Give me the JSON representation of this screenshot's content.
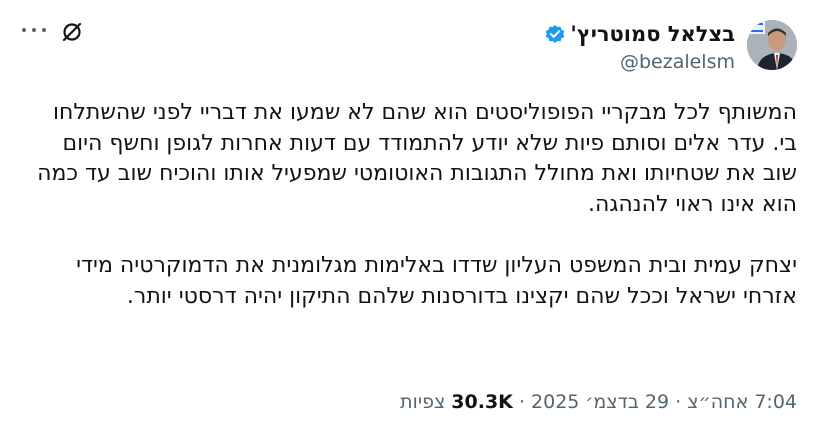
{
  "header": {
    "more_icon": "more-horizontal-icon",
    "grok_icon": "grok-slash-circle-icon"
  },
  "author": {
    "display_name": "בצלאל סמוטריץ'",
    "handle": "@bezalelsm",
    "verified_icon": "verified-badge-icon",
    "avatar_icon": "profile-photo-avatar",
    "verified_color": "#1d9bf0"
  },
  "tweet": {
    "paragraphs": [
      "המשותף לכל מבקריי הפופוליסטים הוא שהם לא שמעו את דבריי לפני שהשתלחו בי. עדר אלים וסותם פיות שלא יודע להתמודד עם דעות אחרות לגופן וחשף היום שוב את שטחיותו ואת מחולל התגובות האוטומטי שמפעיל אותו והוכיח שוב עד כמה הוא אינו ראוי להנהגה.",
      "יצחק עמית ובית המשפט העליון שדדו באלימות מגלומנית את הדמוקרטיה מידי אזרחי ישראל וככל שהם יקצינו בדורסנות שלהם התיקון יהיה דרסטי יותר."
    ]
  },
  "meta": {
    "time": "7:04 אחה״צ",
    "separator": "·",
    "date": "29 בדצמ׳ 2025",
    "views_count": "30.3K",
    "views_label": "צפיות"
  }
}
